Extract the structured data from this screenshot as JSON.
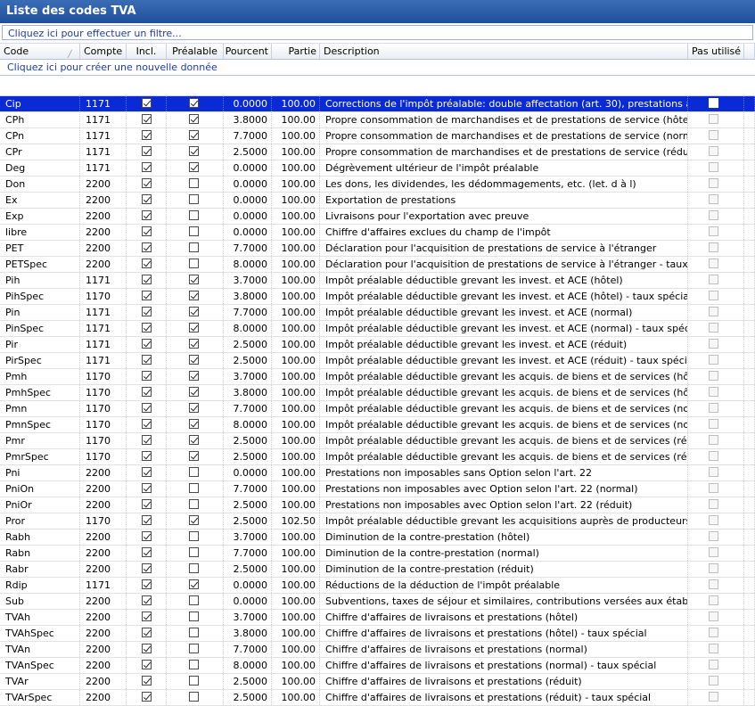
{
  "window": {
    "title": "Liste des codes TVA"
  },
  "filter": {
    "label": "Cliquez ici pour effectuer un filtre..."
  },
  "columns": {
    "code": "Code",
    "compte": "Compte",
    "incl": "Incl.",
    "prealable": "Préalable",
    "pourcent": "Pourcent",
    "partie": "Partie",
    "description": "Description",
    "pas_utilise": "Pas utilisé"
  },
  "new_row": {
    "label": "Cliquez ici pour créer une nouvelle donnée"
  },
  "rows": [
    {
      "code": "Cip",
      "compte": "1171",
      "incl": true,
      "prealable": true,
      "pourcent": "0.0000",
      "partie": "100.00",
      "description": "Corrections de l'impôt préalable: double affectation (art. 30), prestations à so",
      "pas_utilise": false
    },
    {
      "code": "CPh",
      "compte": "1171",
      "incl": true,
      "prealable": true,
      "pourcent": "3.8000",
      "partie": "100.00",
      "description": "Propre consommation de marchandises et de prestations de service (hôtel)",
      "pas_utilise": false
    },
    {
      "code": "CPn",
      "compte": "1171",
      "incl": true,
      "prealable": true,
      "pourcent": "7.7000",
      "partie": "100.00",
      "description": "Propre consommation de marchandises et de prestations de service (normal)",
      "pas_utilise": false
    },
    {
      "code": "CPr",
      "compte": "1171",
      "incl": true,
      "prealable": true,
      "pourcent": "2.5000",
      "partie": "100.00",
      "description": "Propre consommation de marchandises et de prestations de service (réduit)",
      "pas_utilise": false
    },
    {
      "code": "Deg",
      "compte": "1171",
      "incl": true,
      "prealable": true,
      "pourcent": "0.0000",
      "partie": "100.00",
      "description": "Dégrèvement ultérieur de l'impôt préalable",
      "pas_utilise": false
    },
    {
      "code": "Don",
      "compte": "2200",
      "incl": true,
      "prealable": false,
      "pourcent": "0.0000",
      "partie": "100.00",
      "description": "Les dons, les dividendes, les dédommagements, etc. (let. d à l)",
      "pas_utilise": false
    },
    {
      "code": "Ex",
      "compte": "2200",
      "incl": true,
      "prealable": false,
      "pourcent": "0.0000",
      "partie": "100.00",
      "description": "Exportation de prestations",
      "pas_utilise": false
    },
    {
      "code": "Exp",
      "compte": "2200",
      "incl": true,
      "prealable": false,
      "pourcent": "0.0000",
      "partie": "100.00",
      "description": "Livraisons pour l'exportation avec preuve",
      "pas_utilise": false
    },
    {
      "code": "libre",
      "compte": "2200",
      "incl": true,
      "prealable": false,
      "pourcent": "0.0000",
      "partie": "100.00",
      "description": "Chiffre d'affaires exclues du champ de l'impôt",
      "pas_utilise": false
    },
    {
      "code": "PET",
      "compte": "2200",
      "incl": true,
      "prealable": false,
      "pourcent": "7.7000",
      "partie": "100.00",
      "description": "Déclaration pour l'acquisition de prestations de service à l'étranger",
      "pas_utilise": false
    },
    {
      "code": "PETSpec",
      "compte": "2200",
      "incl": true,
      "prealable": false,
      "pourcent": "8.0000",
      "partie": "100.00",
      "description": "Déclaration pour l'acquisition de prestations de service à l'étranger - taux spé",
      "pas_utilise": false
    },
    {
      "code": "Pih",
      "compte": "1171",
      "incl": true,
      "prealable": true,
      "pourcent": "3.7000",
      "partie": "100.00",
      "description": "Impôt préalable déductible grevant les invest. et ACE (hôtel)",
      "pas_utilise": false
    },
    {
      "code": "PihSpec",
      "compte": "1170",
      "incl": true,
      "prealable": true,
      "pourcent": "3.8000",
      "partie": "100.00",
      "description": "Impôt préalable déductible grevant les invest. et ACE (hôtel) - taux spécial",
      "pas_utilise": false
    },
    {
      "code": "Pin",
      "compte": "1171",
      "incl": true,
      "prealable": true,
      "pourcent": "7.7000",
      "partie": "100.00",
      "description": "Impôt préalable déductible grevant les invest. et ACE (normal)",
      "pas_utilise": false
    },
    {
      "code": "PinSpec",
      "compte": "1171",
      "incl": true,
      "prealable": true,
      "pourcent": "8.0000",
      "partie": "100.00",
      "description": "Impôt préalable déductible grevant les invest. et ACE (normal) - taux spécial",
      "pas_utilise": false
    },
    {
      "code": "Pir",
      "compte": "1171",
      "incl": true,
      "prealable": true,
      "pourcent": "2.5000",
      "partie": "100.00",
      "description": "Impôt préalable déductible grevant les invest. et ACE (réduit)",
      "pas_utilise": false
    },
    {
      "code": "PirSpec",
      "compte": "1171",
      "incl": true,
      "prealable": true,
      "pourcent": "2.5000",
      "partie": "100.00",
      "description": "Impôt préalable déductible grevant les invest. et ACE (réduit) - taux spécial",
      "pas_utilise": false
    },
    {
      "code": "Pmh",
      "compte": "1170",
      "incl": true,
      "prealable": true,
      "pourcent": "3.7000",
      "partie": "100.00",
      "description": "Impôt préalable déductible grevant les acquis. de biens et de services (hôtel)",
      "pas_utilise": false
    },
    {
      "code": "PmhSpec",
      "compte": "1170",
      "incl": true,
      "prealable": true,
      "pourcent": "3.8000",
      "partie": "100.00",
      "description": "Impôt préalable déductible grevant les acquis. de biens et de services (hôtel) -",
      "pas_utilise": false
    },
    {
      "code": "Pmn",
      "compte": "1170",
      "incl": true,
      "prealable": true,
      "pourcent": "7.7000",
      "partie": "100.00",
      "description": "Impôt préalable déductible grevant les acquis. de biens et de services (normal)",
      "pas_utilise": false
    },
    {
      "code": "PmnSpec",
      "compte": "1170",
      "incl": true,
      "prealable": true,
      "pourcent": "8.0000",
      "partie": "100.00",
      "description": "Impôt préalable déductible grevant les acquis. de biens et de services (normal)",
      "pas_utilise": false
    },
    {
      "code": "Pmr",
      "compte": "1170",
      "incl": true,
      "prealable": true,
      "pourcent": "2.5000",
      "partie": "100.00",
      "description": "Impôt préalable déductible grevant les acquis. de biens et de services (réduit)",
      "pas_utilise": false
    },
    {
      "code": "PmrSpec",
      "compte": "1170",
      "incl": true,
      "prealable": true,
      "pourcent": "2.5000",
      "partie": "100.00",
      "description": "Impôt préalable déductible grevant les acquis. de biens et de services (réduit)",
      "pas_utilise": false
    },
    {
      "code": "Pni",
      "compte": "2200",
      "incl": true,
      "prealable": false,
      "pourcent": "0.0000",
      "partie": "100.00",
      "description": "Prestations non imposables sans Option selon l'art. 22",
      "pas_utilise": false
    },
    {
      "code": "PniOn",
      "compte": "2200",
      "incl": true,
      "prealable": false,
      "pourcent": "7.7000",
      "partie": "100.00",
      "description": "Prestations non imposables avec Option selon l'art. 22 (normal)",
      "pas_utilise": false
    },
    {
      "code": "PniOr",
      "compte": "2200",
      "incl": true,
      "prealable": false,
      "pourcent": "2.5000",
      "partie": "100.00",
      "description": "Prestations non imposables avec Option selon l'art. 22 (réduit)",
      "pas_utilise": false
    },
    {
      "code": "Pror",
      "compte": "1170",
      "incl": true,
      "prealable": true,
      "pourcent": "2.5000",
      "partie": "102.50",
      "description": "Impôt préalable déductible grevant les acquisitions auprès de producteurs",
      "pas_utilise": false
    },
    {
      "code": "Rabh",
      "compte": "2200",
      "incl": true,
      "prealable": false,
      "pourcent": "3.7000",
      "partie": "100.00",
      "description": "Diminution de la contre-prestation (hôtel)",
      "pas_utilise": false
    },
    {
      "code": "Rabn",
      "compte": "2200",
      "incl": true,
      "prealable": false,
      "pourcent": "7.7000",
      "partie": "100.00",
      "description": "Diminution de la contre-prestation (normal)",
      "pas_utilise": false
    },
    {
      "code": "Rabr",
      "compte": "2200",
      "incl": true,
      "prealable": false,
      "pourcent": "2.5000",
      "partie": "100.00",
      "description": "Diminution de la contre-prestation (réduit)",
      "pas_utilise": false
    },
    {
      "code": "Rdip",
      "compte": "1171",
      "incl": true,
      "prealable": true,
      "pourcent": "0.0000",
      "partie": "100.00",
      "description": "Réductions de la déduction de l'impôt préalable",
      "pas_utilise": false
    },
    {
      "code": "Sub",
      "compte": "2200",
      "incl": true,
      "prealable": false,
      "pourcent": "0.0000",
      "partie": "100.00",
      "description": "Subventions, taxes de séjour et similaires, contributions versées aux établissem",
      "pas_utilise": false
    },
    {
      "code": "TVAh",
      "compte": "2200",
      "incl": true,
      "prealable": false,
      "pourcent": "3.7000",
      "partie": "100.00",
      "description": "Chiffre d'affaires de livraisons et prestations (hôtel)",
      "pas_utilise": false
    },
    {
      "code": "TVAhSpec",
      "compte": "2200",
      "incl": true,
      "prealable": false,
      "pourcent": "3.8000",
      "partie": "100.00",
      "description": "Chiffre d'affaires de livraisons et prestations (hôtel) - taux spécial",
      "pas_utilise": false
    },
    {
      "code": "TVAn",
      "compte": "2200",
      "incl": true,
      "prealable": false,
      "pourcent": "7.7000",
      "partie": "100.00",
      "description": "Chiffre d'affaires de livraisons et prestations (normal)",
      "pas_utilise": false
    },
    {
      "code": "TVAnSpec",
      "compte": "2200",
      "incl": true,
      "prealable": false,
      "pourcent": "8.0000",
      "partie": "100.00",
      "description": "Chiffre d'affaires de livraisons et prestations (normal) - taux spécial",
      "pas_utilise": false
    },
    {
      "code": "TVAr",
      "compte": "2200",
      "incl": true,
      "prealable": false,
      "pourcent": "2.5000",
      "partie": "100.00",
      "description": "Chiffre d'affaires de livraisons et prestations (réduit)",
      "pas_utilise": false
    },
    {
      "code": "TVArSpec",
      "compte": "2200",
      "incl": true,
      "prealable": false,
      "pourcent": "2.5000",
      "partie": "100.00",
      "description": "Chiffre d'affaires de livraisons et prestations (réduit) - taux spécial",
      "pas_utilise": false
    }
  ],
  "selected_row": 0,
  "colors": {
    "title_bar": "#1f4f9a",
    "selection": "#0a2ad6",
    "link": "#1d3ba8"
  },
  "icons": {
    "sort": "sort-indicator-icon",
    "checkbox": "checkbox-icon"
  }
}
